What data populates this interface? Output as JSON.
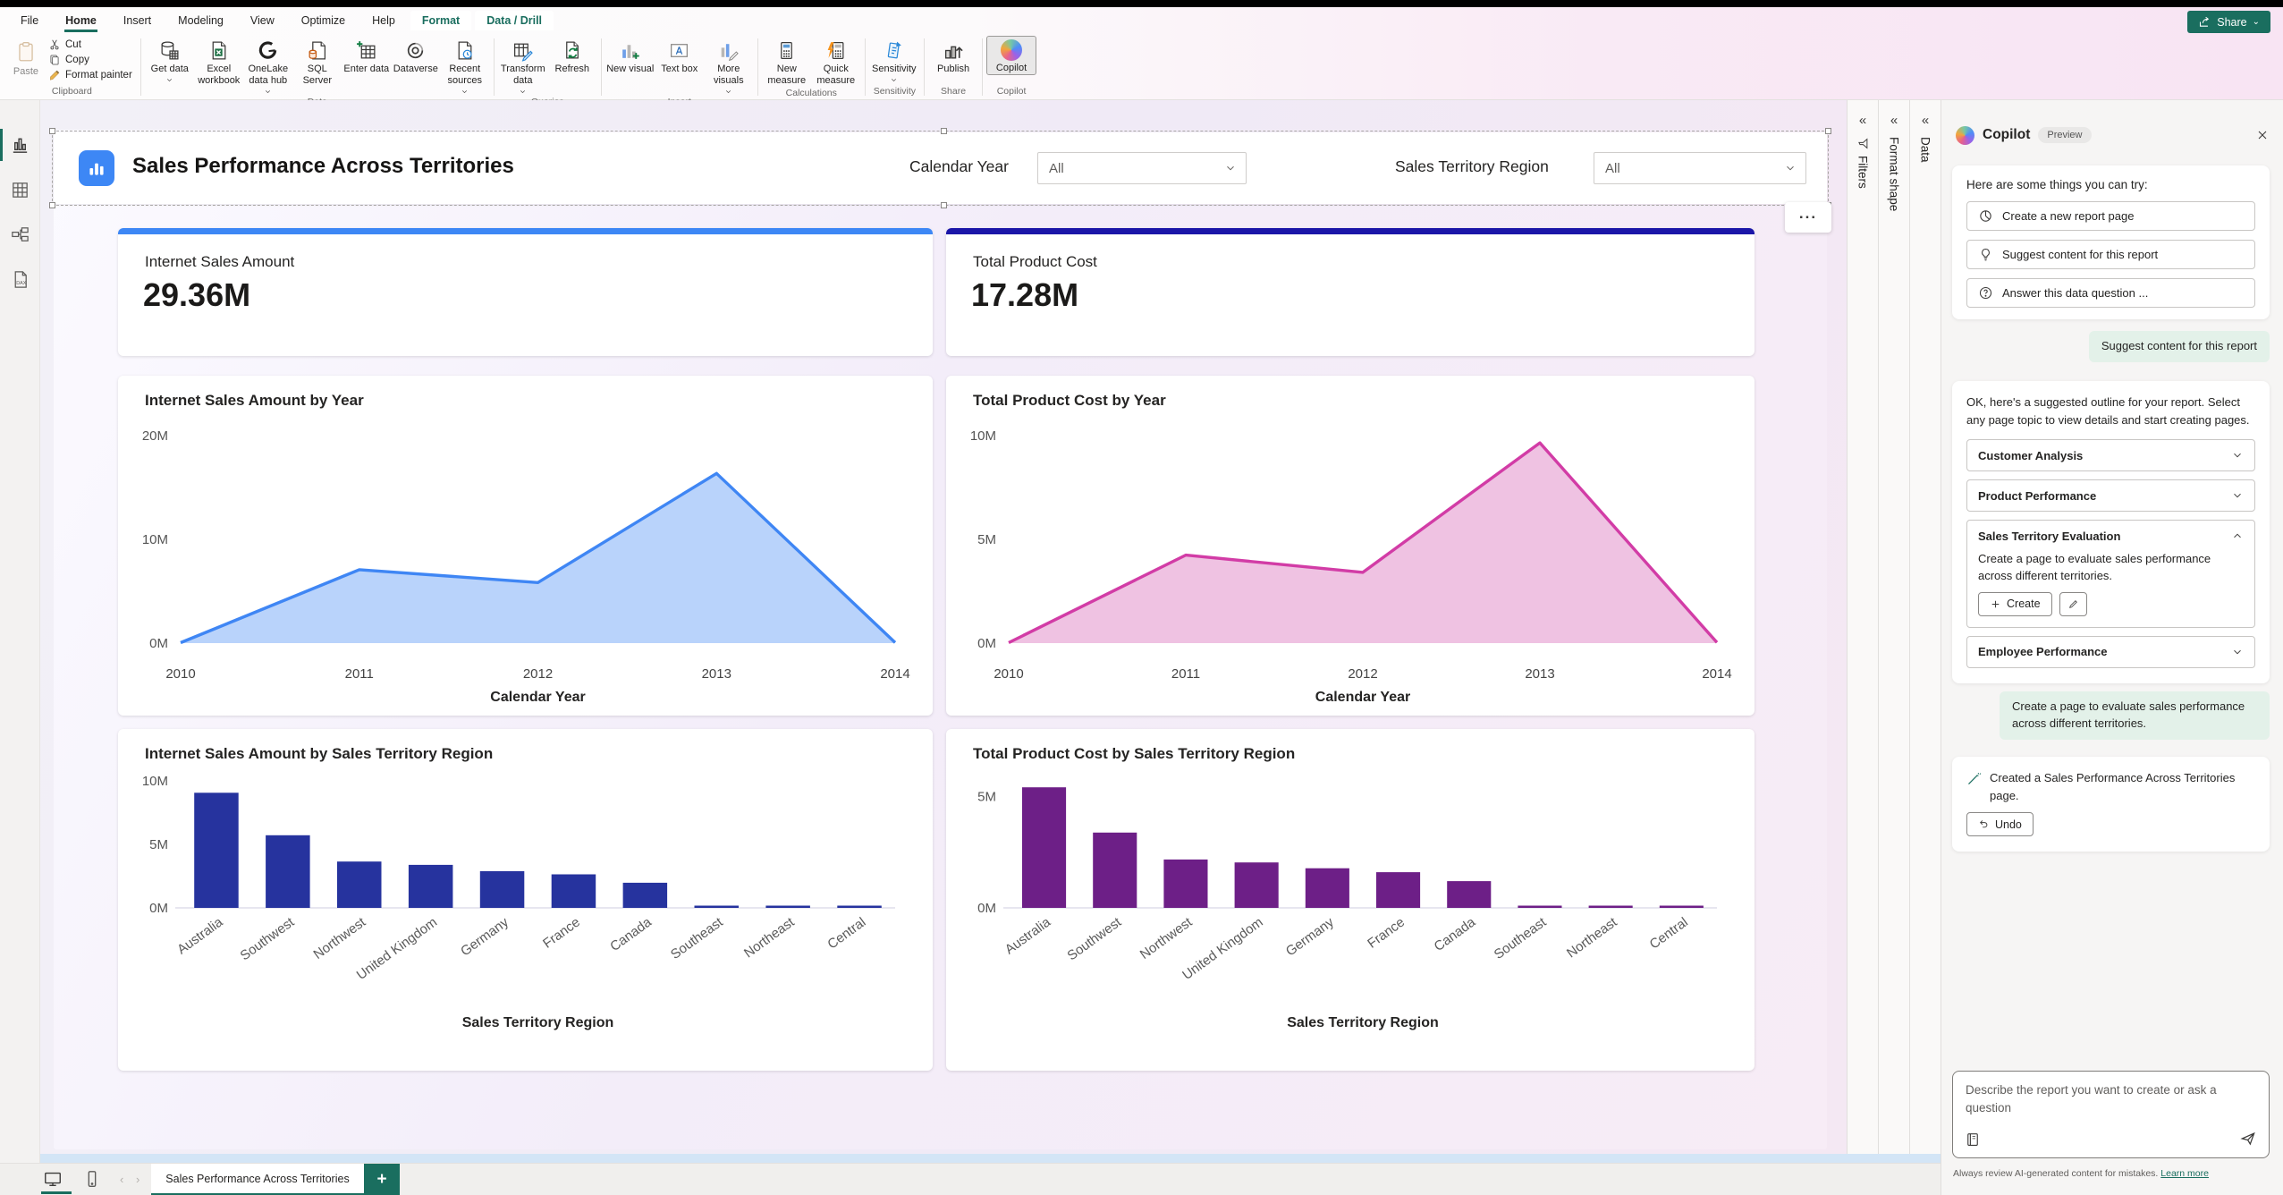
{
  "theme": {
    "teal": "#1a6e5f",
    "kpi_blue_accent": "#3d87f5",
    "kpi_navy_accent": "#1b16a8",
    "area_blue_line": "#3f86f4",
    "area_blue_fill": "#b9d3fb",
    "area_pink_line": "#d23ca6",
    "area_pink_fill": "#efc2e2",
    "bar_navy": "#26339e",
    "bar_purple": "#6d1f87"
  },
  "ribbon": {
    "menu_tabs": [
      {
        "label": "File",
        "state": "normal"
      },
      {
        "label": "Home",
        "state": "active"
      },
      {
        "label": "Insert",
        "state": "normal"
      },
      {
        "label": "Modeling",
        "state": "normal"
      },
      {
        "label": "View",
        "state": "normal"
      },
      {
        "label": "Optimize",
        "state": "normal"
      },
      {
        "label": "Help",
        "state": "normal"
      },
      {
        "label": "Format",
        "state": "contextual"
      },
      {
        "label": "Data / Drill",
        "state": "contextual"
      }
    ],
    "share_label": "Share",
    "groups": [
      {
        "label": "Clipboard",
        "layout": "clipboard",
        "big": {
          "label": "Paste",
          "icon": "paste"
        },
        "small": [
          {
            "label": "Cut",
            "icon": "cut"
          },
          {
            "label": "Copy",
            "icon": "copy"
          },
          {
            "label": "Format painter",
            "icon": "format-painter"
          }
        ]
      },
      {
        "label": "Data",
        "buttons": [
          {
            "label": "Get data",
            "icon": "get-data",
            "dd": true
          },
          {
            "label": "Excel workbook",
            "icon": "excel-workbook"
          },
          {
            "label": "OneLake data hub",
            "icon": "onelake-data-hub",
            "dd": true
          },
          {
            "label": "SQL Server",
            "icon": "sql-server"
          },
          {
            "label": "Enter data",
            "icon": "enter-data"
          },
          {
            "label": "Dataverse",
            "icon": "dataverse"
          },
          {
            "label": "Recent sources",
            "icon": "recent-sources",
            "dd": true
          }
        ]
      },
      {
        "label": "Queries",
        "buttons": [
          {
            "label": "Transform data",
            "icon": "transform-data",
            "dd": true
          },
          {
            "label": "Refresh",
            "icon": "refresh"
          }
        ]
      },
      {
        "label": "Insert",
        "buttons": [
          {
            "label": "New visual",
            "icon": "new-visual"
          },
          {
            "label": "Text box",
            "icon": "text-box"
          },
          {
            "label": "More visuals",
            "icon": "more-visuals",
            "dd": true
          }
        ]
      },
      {
        "label": "Calculations",
        "buttons": [
          {
            "label": "New measure",
            "icon": "new-measure"
          },
          {
            "label": "Quick measure",
            "icon": "quick-measure"
          }
        ]
      },
      {
        "label": "Sensitivity",
        "buttons": [
          {
            "label": "Sensitivity",
            "icon": "sensitivity",
            "dd": true
          }
        ]
      },
      {
        "label": "Share",
        "buttons": [
          {
            "label": "Publish",
            "icon": "publish"
          }
        ]
      },
      {
        "label": "Copilot",
        "buttons": [
          {
            "label": "Copilot",
            "icon": "copilot",
            "selected": true
          }
        ]
      }
    ]
  },
  "canvas_header": {
    "title": "Sales Performance Across Territories",
    "slicers": [
      {
        "label": "Calendar Year",
        "value": "All"
      },
      {
        "label": "Sales Territory Region",
        "value": "All"
      }
    ],
    "more_options_label": "..."
  },
  "chart_data": [
    {
      "type": "card",
      "title": "Internet Sales Amount",
      "value": "29.36M",
      "accent": "#3d87f5"
    },
    {
      "type": "card",
      "title": "Total Product Cost",
      "value": "17.28M",
      "accent": "#1b16a8"
    },
    {
      "type": "area",
      "title": "Internet Sales Amount by Year",
      "x": [
        "2010",
        "2011",
        "2012",
        "2013",
        "2014"
      ],
      "values": [
        0.04,
        7.08,
        5.84,
        16.35,
        0.05
      ],
      "xlabel": "Calendar Year",
      "ylim": [
        0,
        20
      ],
      "ytick_values": [
        0,
        10,
        20
      ],
      "ytick_labels": [
        "0M",
        "10M",
        "20M"
      ],
      "line_color": "#3f86f4",
      "fill_color": "#b9d3fb"
    },
    {
      "type": "area",
      "title": "Total Product Cost by Year",
      "x": [
        "2010",
        "2011",
        "2012",
        "2013",
        "2014"
      ],
      "values": [
        0.02,
        4.24,
        3.41,
        9.65,
        0.03
      ],
      "xlabel": "Calendar Year",
      "ylim": [
        0,
        10
      ],
      "ytick_values": [
        0,
        5,
        10
      ],
      "ytick_labels": [
        "0M",
        "5M",
        "10M"
      ],
      "line_color": "#d23ca6",
      "fill_color": "#efc2e2"
    },
    {
      "type": "bar",
      "title": "Internet Sales Amount by Sales Territory Region",
      "categories": [
        "Australia",
        "Southwest",
        "Northwest",
        "United Kingdom",
        "Germany",
        "France",
        "Canada",
        "Southeast",
        "Northeast",
        "Central"
      ],
      "values": [
        9.06,
        5.72,
        3.65,
        3.39,
        2.89,
        2.64,
        1.98,
        0.12,
        0.11,
        0.08
      ],
      "xlabel": "Sales Territory Region",
      "ylim": [
        0,
        10
      ],
      "ytick_values": [
        0,
        5,
        10
      ],
      "ytick_labels": [
        "0M",
        "5M",
        "10M"
      ],
      "bar_color": "#26339e"
    },
    {
      "type": "bar",
      "title": "Total Product Cost by Sales Territory Region",
      "categories": [
        "Australia",
        "Southwest",
        "Northwest",
        "United Kingdom",
        "Germany",
        "France",
        "Canada",
        "Southeast",
        "Northeast",
        "Central"
      ],
      "values": [
        5.41,
        3.38,
        2.17,
        2.04,
        1.78,
        1.6,
        1.2,
        0.07,
        0.06,
        0.05
      ],
      "xlabel": "Sales Territory Region",
      "ylim": [
        0,
        5.7
      ],
      "ytick_values": [
        0,
        5
      ],
      "ytick_labels": [
        "0M",
        "5M"
      ],
      "bar_color": "#6d1f87"
    }
  ],
  "panes": {
    "collapsed": [
      "Filters",
      "Format shape",
      "Data"
    ]
  },
  "copilot": {
    "title": "Copilot",
    "badge": "Preview",
    "intro_card": {
      "heading": "Here are some things you can try:",
      "suggestions": [
        {
          "icon": "pie-chart",
          "label": "Create a new report page"
        },
        {
          "icon": "lightbulb",
          "label": "Suggest content for this report"
        },
        {
          "icon": "question-bubble",
          "label": "Answer this data question ..."
        }
      ]
    },
    "user_message_1": "Suggest content for this report",
    "outline_card": {
      "intro": "OK, here's a suggested outline for your report. Select any page topic to view details and start creating pages.",
      "topics": [
        {
          "label": "Customer Analysis",
          "expanded": false
        },
        {
          "label": "Product Performance",
          "expanded": false
        },
        {
          "label": "Sales Territory Evaluation",
          "expanded": true,
          "description": "Create a page to evaluate sales performance across different territories.",
          "create_label": "Create"
        },
        {
          "label": "Employee Performance",
          "expanded": false
        }
      ]
    },
    "user_message_2": "Create a page to evaluate sales performance across different territories.",
    "result_card": {
      "text": "Created a Sales Performance Across Territories page.",
      "undo_label": "Undo"
    },
    "input_placeholder": "Describe the report you want to create or ask a question",
    "footer_text": "Always review AI-generated content for mistakes.",
    "footer_link": "Learn more"
  },
  "bottom_bar": {
    "page_tab": "Sales Performance Across Territories",
    "new_page_label": "+"
  }
}
